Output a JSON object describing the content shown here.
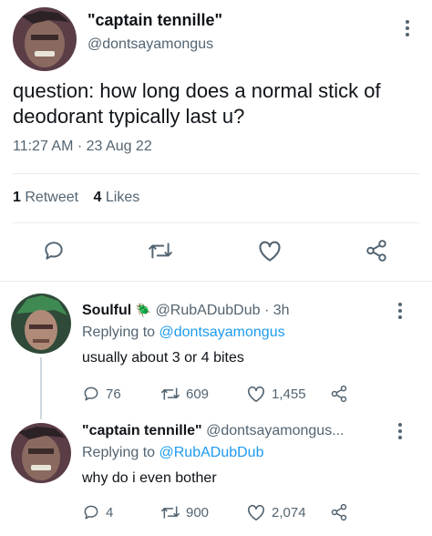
{
  "main_tweet": {
    "display_name": "\"captain tennille\"",
    "handle": "@dontsayamongus",
    "text": "question: how long does a normal stick of deodorant typically last u?",
    "time": "11:27 AM",
    "separator": "·",
    "date": "23 Aug 22",
    "stats": {
      "retweets_count": "1",
      "retweets_label": "Retweet",
      "likes_count": "4",
      "likes_label": "Likes"
    }
  },
  "replies": [
    {
      "display_name": "Soulful",
      "badge_emoji": "🪲",
      "handle": "@RubADubDub",
      "separator": "·",
      "time_ago": "3h",
      "replying_to_label": "Replying to",
      "replying_to_handle": "@dontsayamongus",
      "text": "usually about 3 or 4 bites",
      "replies_count": "76",
      "retweets_count": "609",
      "likes_count": "1,455"
    },
    {
      "display_name": "\"captain tennille\"",
      "handle": "@dontsayamongus...",
      "replying_to_label": "Replying to",
      "replying_to_handle": "@RubADubDub",
      "text": "why do i even bother",
      "replies_count": "4",
      "retweets_count": "900",
      "likes_count": "2,074"
    }
  ],
  "colors": {
    "text": "#0f1419",
    "muted": "#536471",
    "link": "#1d9bf0",
    "divider": "#e6ecf0"
  },
  "icons": [
    "reply-icon",
    "retweet-icon",
    "like-icon",
    "share-icon",
    "more-icon"
  ]
}
